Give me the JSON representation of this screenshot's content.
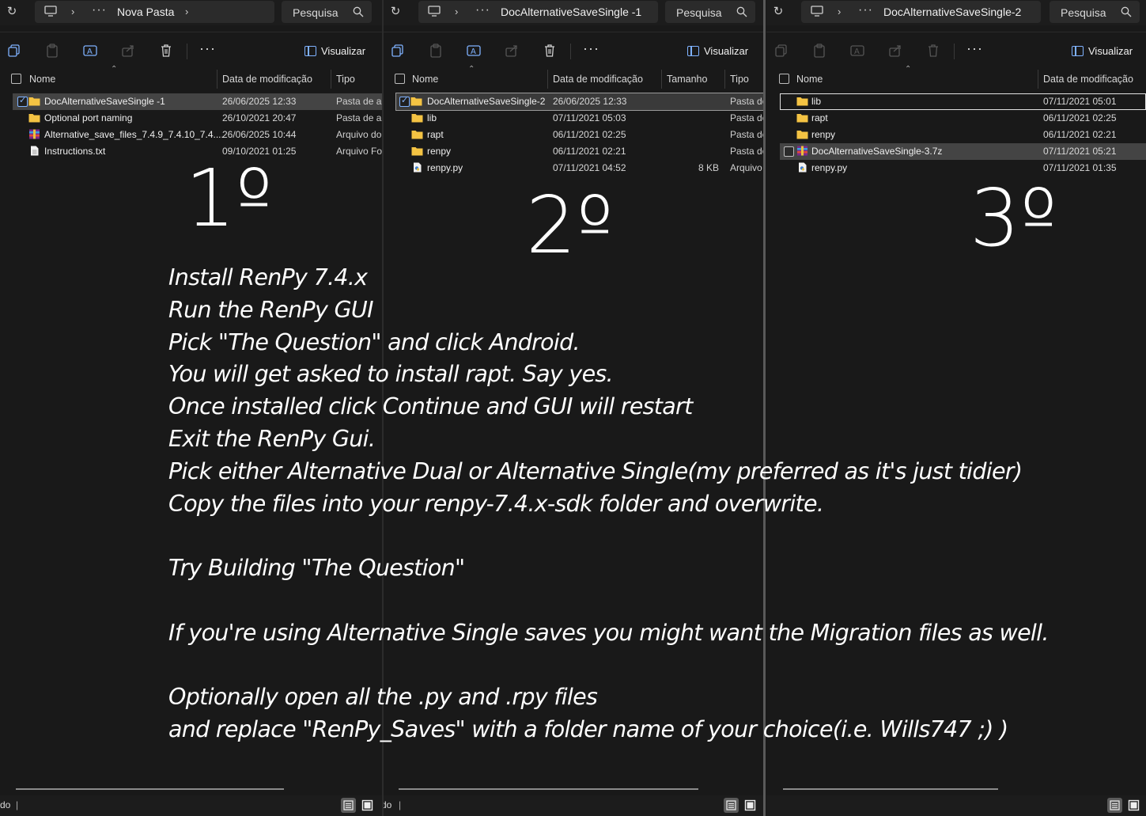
{
  "panes": [
    {
      "breadcrumb": "Nova Pasta",
      "search_placeholder": "Pesquisa",
      "view_label": "Visualizar",
      "columns": [
        "Nome",
        "Data de modificação",
        "Tipo"
      ],
      "files": [
        {
          "name": "DocAlternativeSaveSingle -1",
          "date": "26/06/2025 12:33",
          "type": "Pasta de ar",
          "icon": "folder-icon",
          "selected": true
        },
        {
          "name": "Optional port naming",
          "date": "26/10/2021 20:47",
          "type": "Pasta de ar",
          "icon": "folder-icon"
        },
        {
          "name": "Alternative_save_files_7.4.9_7.4.10_7.4....",
          "date": "26/06/2025 10:44",
          "type": "Arquivo do",
          "icon": "archive-icon"
        },
        {
          "name": "Instructions.txt",
          "date": "09/10/2021 01:25",
          "type": "Arquivo Fo",
          "icon": "text-file-icon"
        }
      ],
      "step_label": "1º",
      "status_text": "do"
    },
    {
      "breadcrumb": "DocAlternativeSaveSingle -1",
      "search_placeholder": "Pesquisa",
      "view_label": "Visualizar",
      "columns": [
        "Nome",
        "Data de modificação",
        "Tamanho",
        "Tipo"
      ],
      "files": [
        {
          "name": "DocAlternativeSaveSingle-2",
          "date": "26/06/2025 12:33",
          "size": "",
          "type": "Pasta de",
          "icon": "folder-icon",
          "selected": true
        },
        {
          "name": "lib",
          "date": "07/11/2021 05:03",
          "size": "",
          "type": "Pasta de",
          "icon": "folder-icon"
        },
        {
          "name": "rapt",
          "date": "06/11/2021 02:25",
          "size": "",
          "type": "Pasta de",
          "icon": "folder-icon"
        },
        {
          "name": "renpy",
          "date": "06/11/2021 02:21",
          "size": "",
          "type": "Pasta de",
          "icon": "folder-icon"
        },
        {
          "name": "renpy.py",
          "date": "07/11/2021 04:52",
          "size": "8 KB",
          "type": "Arquivo",
          "icon": "python-file-icon"
        }
      ],
      "step_label": "2º",
      "status_text": "do"
    },
    {
      "breadcrumb": "DocAlternativeSaveSingle-2",
      "search_placeholder": "Pesquisa",
      "view_label": "Visualizar",
      "columns": [
        "Nome",
        "Data de modificação"
      ],
      "files": [
        {
          "name": "lib",
          "date": "07/11/2021 05:01",
          "icon": "folder-icon",
          "focused": true
        },
        {
          "name": "rapt",
          "date": "06/11/2021 02:25",
          "icon": "folder-icon"
        },
        {
          "name": "renpy",
          "date": "06/11/2021 02:21",
          "icon": "folder-icon"
        },
        {
          "name": "DocAlternativeSaveSingle-3.7z",
          "date": "07/11/2021 05:21",
          "icon": "archive-icon",
          "selected": true
        },
        {
          "name": "renpy.py",
          "date": "07/11/2021 01:35",
          "icon": "python-file-icon"
        }
      ],
      "step_label": "3º",
      "status_text": ""
    }
  ],
  "instructions": [
    "Install RenPy 7.4.x",
    "Run the RenPy GUI",
    "Pick \"The Question\" and click Android.",
    "You will get asked to install rapt. Say yes.",
    "Once installed click Continue and GUI will restart",
    "Exit the RenPy Gui.",
    "Pick either Alternative Dual or Alternative Single(my preferred as it's just tidier)",
    "Copy the files into your renpy-7.4.x-sdk folder and overwrite.",
    "",
    "Try Building \"The Question\"",
    "",
    "If you're using Alternative Single saves you might want the Migration files as well.",
    "",
    "Optionally open all the .py and .rpy files",
    "and replace \"RenPy_Saves\" with a folder name of your choice(i.e. Wills747 ;) )"
  ],
  "colors": {
    "background": "#191919",
    "folder": "#f4c343",
    "accent": "#7fb2ff",
    "selected_row": "#444444"
  }
}
